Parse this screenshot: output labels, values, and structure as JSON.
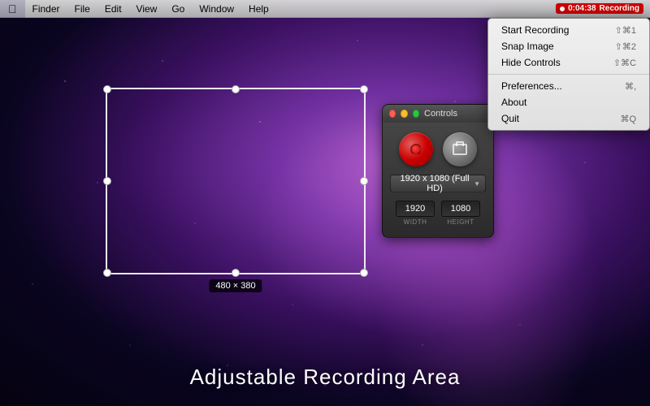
{
  "menubar": {
    "apple": "⌘",
    "items": [
      {
        "label": "Finder"
      },
      {
        "label": "File"
      },
      {
        "label": "Edit"
      },
      {
        "label": "View"
      },
      {
        "label": "Go"
      },
      {
        "label": "Window"
      },
      {
        "label": "Help"
      }
    ],
    "recording_time": "0:04:38",
    "recording_label": "Recording"
  },
  "dropdown": {
    "items": [
      {
        "label": "Start Recording",
        "shortcut": "⇧⌘1"
      },
      {
        "label": "Snap Image",
        "shortcut": "⇧⌘2"
      },
      {
        "label": "Hide Controls",
        "shortcut": "⇧⌘C"
      },
      {
        "separator": true
      },
      {
        "label": "Preferences...",
        "shortcut": "⌘,"
      },
      {
        "label": "About",
        "shortcut": ""
      },
      {
        "label": "Quit",
        "shortcut": "⌘Q"
      }
    ]
  },
  "recording_area": {
    "size_label": "480 × 380"
  },
  "controls": {
    "title": "Controls",
    "resolution": "1920 x 1080 (Full HD)",
    "width_value": "1920",
    "height_value": "1080",
    "width_label": "WIDTH",
    "height_label": "HEIGHT",
    "record_btn_label": "Record",
    "snap_btn_label": "Snap Image"
  },
  "bottom_text": "Adjustable Recording Area"
}
